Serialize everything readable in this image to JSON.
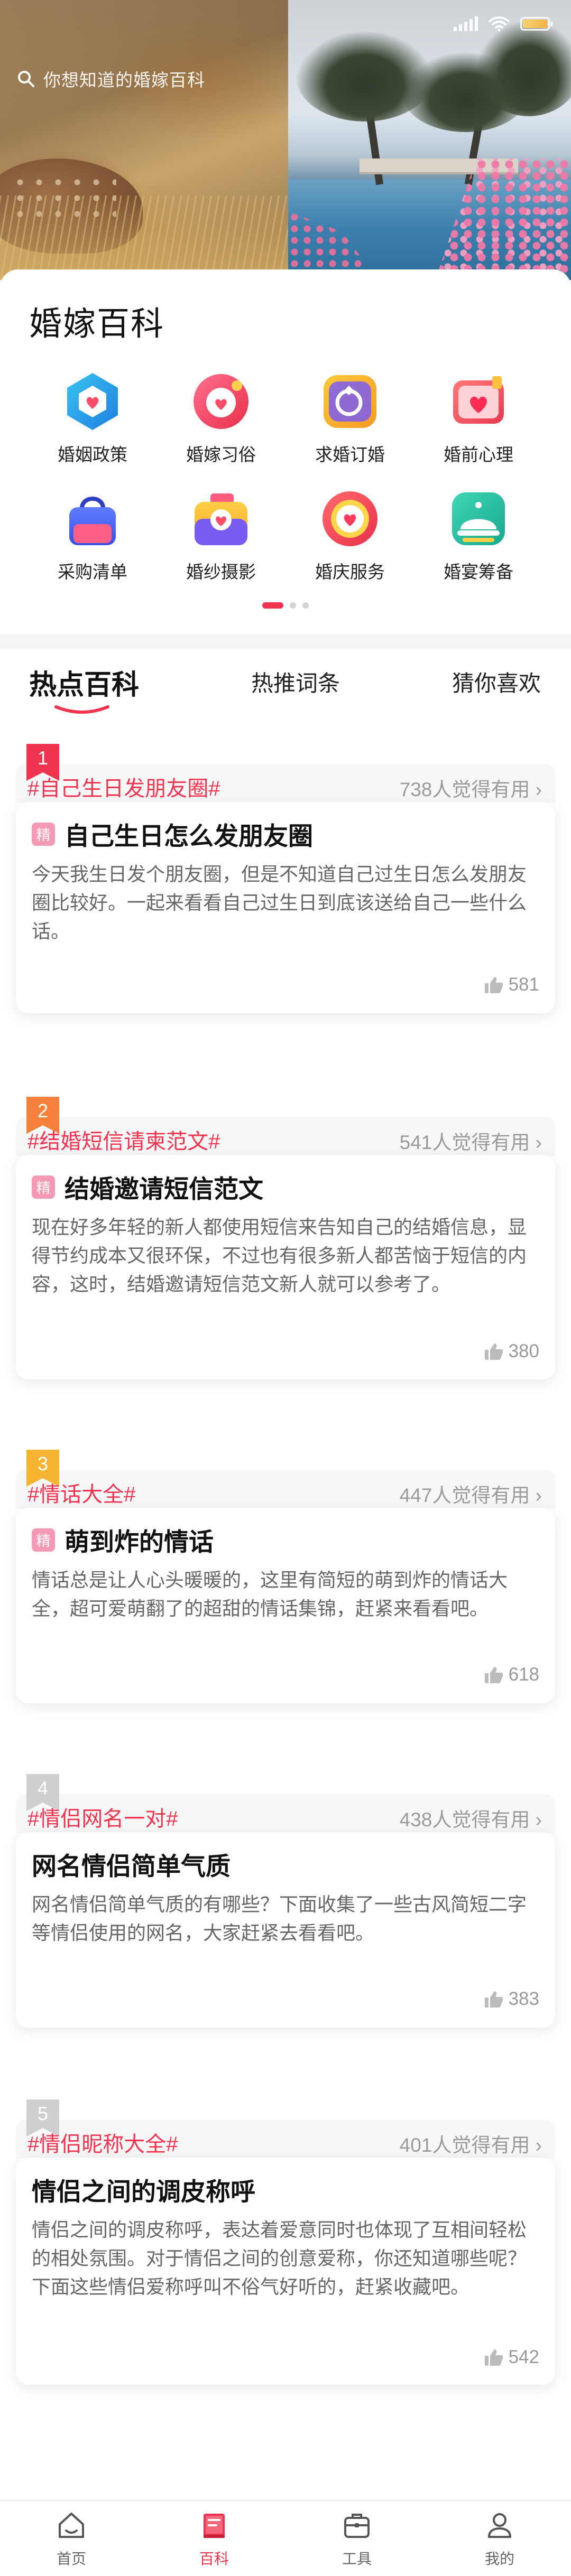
{
  "hero": {
    "search": {
      "placeholder": "你想知道的婚嫁百科",
      "icon": "search-icon"
    }
  },
  "colors": {
    "accent": "#f0344f",
    "rank1": "#f0344f",
    "rank2": "#f5813a",
    "rank3": "#f5b533",
    "rank_other": "#cfcfcf",
    "badge": "#f49ab4"
  },
  "category": {
    "title": "婚嫁百科",
    "items": [
      {
        "label": "婚姻政策",
        "icon": "marriage-policy-icon"
      },
      {
        "label": "婚嫁习俗",
        "icon": "wedding-custom-icon"
      },
      {
        "label": "求婚订婚",
        "icon": "proposal-ring-icon"
      },
      {
        "label": "婚前心理",
        "icon": "heart-tv-icon"
      },
      {
        "label": "采购清单",
        "icon": "shopping-bag-icon"
      },
      {
        "label": "婚纱摄影",
        "icon": "camera-icon"
      },
      {
        "label": "婚庆服务",
        "icon": "heart-location-icon"
      },
      {
        "label": "婚宴筹备",
        "icon": "food-cloche-icon"
      }
    ],
    "page_count": 3,
    "page_active": 1
  },
  "tabs": [
    {
      "label": "热点百科",
      "active": true
    },
    {
      "label": "热推词条",
      "active": false
    },
    {
      "label": "猜你喜欢",
      "active": false
    }
  ],
  "articles": [
    {
      "rank": "1",
      "tag": "#自己生日发朋友圈#",
      "useful": "738人觉得有用",
      "badge": "精",
      "title": "自己生日怎么发朋友圈",
      "desc": "今天我生日发个朋友圈，但是不知道自己过生日怎么发朋友圈比较好。一起来看看自己过生日到底该送给自己一些什么话。",
      "likes": "581"
    },
    {
      "rank": "2",
      "tag": "#结婚短信请柬范文#",
      "useful": "541人觉得有用",
      "badge": "精",
      "title": "结婚邀请短信范文",
      "desc": "现在好多年轻的新人都使用短信来告知自己的结婚信息，显得节约成本又很环保，不过也有很多新人都苦恼于短信的内容，这时，结婚邀请短信范文新人就可以参考了。",
      "likes": "380"
    },
    {
      "rank": "3",
      "tag": "#情话大全#",
      "useful": "447人觉得有用",
      "badge": "精",
      "title": "萌到炸的情话",
      "desc": "情话总是让人心头暖暖的，这里有简短的萌到炸的情话大全，超可爱萌翻了的超甜的情话集锦，赶紧来看看吧。",
      "likes": "618"
    },
    {
      "rank": "4",
      "tag": "#情侣网名一对#",
      "useful": "438人觉得有用",
      "badge": "",
      "title": "网名情侣简单气质",
      "desc": "网名情侣简单气质的有哪些？下面收集了一些古风简短二字等情侣使用的网名，大家赶紧去看看吧。",
      "likes": "383"
    },
    {
      "rank": "5",
      "tag": "#情侣昵称大全#",
      "useful": "401人觉得有用",
      "badge": "",
      "title": "情侣之间的调皮称呼",
      "desc": "情侣之间的调皮称呼，表达着爱意同时也体现了互相间轻松的相处氛围。对于情侣之间的创意爱称，你还知道哪些呢？下面这些情侣爱称呼叫不俗气好听的，赶紧收藏吧。",
      "likes": "542"
    }
  ],
  "bottom_nav": [
    {
      "label": "首页",
      "icon": "home-icon",
      "active": false
    },
    {
      "label": "百科",
      "icon": "book-icon",
      "active": true
    },
    {
      "label": "工具",
      "icon": "toolbox-icon",
      "active": false
    },
    {
      "label": "我的",
      "icon": "user-icon",
      "active": false
    }
  ]
}
